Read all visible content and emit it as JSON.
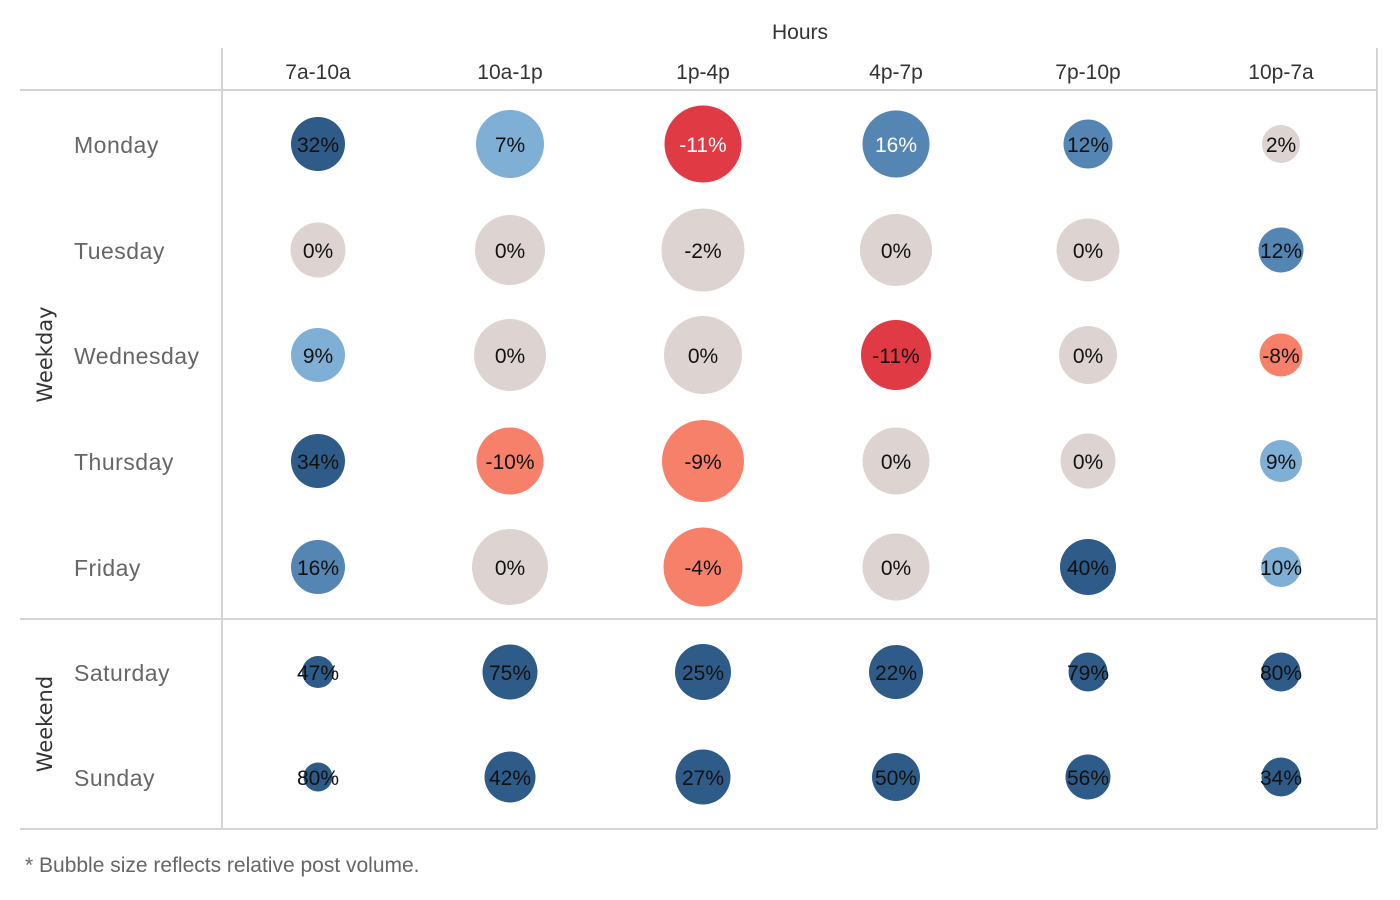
{
  "chart_data": {
    "type": "scatter",
    "subtype": "bubble-grid",
    "title": "",
    "column_header": "Hours",
    "columns": [
      "7a-10a",
      "10a-1p",
      "1p-4p",
      "4p-7p",
      "7p-10p",
      "10p-7a"
    ],
    "groups": [
      {
        "name": "Weekday",
        "rows": [
          "Monday",
          "Tuesday",
          "Wednesday",
          "Thursday",
          "Friday"
        ]
      },
      {
        "name": "Weekend",
        "rows": [
          "Saturday",
          "Sunday"
        ]
      }
    ],
    "cells": [
      {
        "row": "Monday",
        "values": [
          {
            "label": "32%",
            "change": 32,
            "volume": 54,
            "color": "#2e5b87",
            "text_color": "#111111"
          },
          {
            "label": "7%",
            "change": 7,
            "volume": 68,
            "color": "#7fafd4",
            "text_color": "#111111"
          },
          {
            "label": "-11%",
            "change": -11,
            "volume": 77,
            "color": "#e03a44",
            "text_color": "#ffffff"
          },
          {
            "label": "16%",
            "change": 16,
            "volume": 67,
            "color": "#5585b3",
            "text_color": "#ffffff"
          },
          {
            "label": "12%",
            "change": 12,
            "volume": 49,
            "color": "#5585b3",
            "text_color": "#111111"
          },
          {
            "label": "2%",
            "change": 2,
            "volume": 38,
            "color": "#ddd4d2",
            "text_color": "#111111"
          }
        ]
      },
      {
        "row": "Tuesday",
        "values": [
          {
            "label": "0%",
            "change": 0,
            "volume": 55,
            "color": "#ddd4d2",
            "text_color": "#111111"
          },
          {
            "label": "0%",
            "change": 0,
            "volume": 70,
            "color": "#ddd4d2",
            "text_color": "#111111"
          },
          {
            "label": "-2%",
            "change": -2,
            "volume": 83,
            "color": "#ddd4d2",
            "text_color": "#111111"
          },
          {
            "label": "0%",
            "change": 0,
            "volume": 72,
            "color": "#ddd4d2",
            "text_color": "#111111"
          },
          {
            "label": "0%",
            "change": 0,
            "volume": 63,
            "color": "#ddd4d2",
            "text_color": "#111111"
          },
          {
            "label": "12%",
            "change": 12,
            "volume": 45,
            "color": "#5585b3",
            "text_color": "#111111"
          }
        ]
      },
      {
        "row": "Wednesday",
        "values": [
          {
            "label": "9%",
            "change": 9,
            "volume": 54,
            "color": "#7fafd4",
            "text_color": "#111111"
          },
          {
            "label": "0%",
            "change": 0,
            "volume": 72,
            "color": "#ddd4d2",
            "text_color": "#111111"
          },
          {
            "label": "0%",
            "change": 0,
            "volume": 78,
            "color": "#ddd4d2",
            "text_color": "#111111"
          },
          {
            "label": "-11%",
            "change": -11,
            "volume": 70,
            "color": "#e03a44",
            "text_color": "#111111"
          },
          {
            "label": "0%",
            "change": 0,
            "volume": 58,
            "color": "#ddd4d2",
            "text_color": "#111111"
          },
          {
            "label": "-8%",
            "change": -8,
            "volume": 43,
            "color": "#f7806b",
            "text_color": "#111111"
          }
        ]
      },
      {
        "row": "Thursday",
        "values": [
          {
            "label": "34%",
            "change": 34,
            "volume": 54,
            "color": "#2e5b87",
            "text_color": "#111111"
          },
          {
            "label": "-10%",
            "change": -10,
            "volume": 67,
            "color": "#f7806b",
            "text_color": "#111111"
          },
          {
            "label": "-9%",
            "change": -9,
            "volume": 82,
            "color": "#f7806b",
            "text_color": "#111111"
          },
          {
            "label": "0%",
            "change": 0,
            "volume": 67,
            "color": "#ddd4d2",
            "text_color": "#111111"
          },
          {
            "label": "0%",
            "change": 0,
            "volume": 55,
            "color": "#ddd4d2",
            "text_color": "#111111"
          },
          {
            "label": "9%",
            "change": 9,
            "volume": 42,
            "color": "#7fafd4",
            "text_color": "#111111"
          }
        ]
      },
      {
        "row": "Friday",
        "values": [
          {
            "label": "16%",
            "change": 16,
            "volume": 54,
            "color": "#5585b3",
            "text_color": "#111111"
          },
          {
            "label": "0%",
            "change": 0,
            "volume": 76,
            "color": "#ddd4d2",
            "text_color": "#111111"
          },
          {
            "label": "-4%",
            "change": -4,
            "volume": 79,
            "color": "#f7806b",
            "text_color": "#111111"
          },
          {
            "label": "0%",
            "change": 0,
            "volume": 67,
            "color": "#ddd4d2",
            "text_color": "#111111"
          },
          {
            "label": "40%",
            "change": 40,
            "volume": 56,
            "color": "#2e5b87",
            "text_color": "#111111"
          },
          {
            "label": "10%",
            "change": 10,
            "volume": 40,
            "color": "#7fafd4",
            "text_color": "#111111"
          }
        ]
      },
      {
        "row": "Saturday",
        "values": [
          {
            "label": "47%",
            "change": 47,
            "volume": 32,
            "color": "#2e5b87",
            "text_color": "#111111"
          },
          {
            "label": "75%",
            "change": 75,
            "volume": 55,
            "color": "#2e5b87",
            "text_color": "#111111"
          },
          {
            "label": "25%",
            "change": 25,
            "volume": 56,
            "color": "#2e5b87",
            "text_color": "#111111"
          },
          {
            "label": "22%",
            "change": 22,
            "volume": 54,
            "color": "#2e5b87",
            "text_color": "#111111"
          },
          {
            "label": "79%",
            "change": 79,
            "volume": 39,
            "color": "#2e5b87",
            "text_color": "#111111"
          },
          {
            "label": "80%",
            "change": 80,
            "volume": 39,
            "color": "#2e5b87",
            "text_color": "#111111"
          }
        ]
      },
      {
        "row": "Sunday",
        "values": [
          {
            "label": "80%",
            "change": 80,
            "volume": 29,
            "color": "#2e5b87",
            "text_color": "#111111"
          },
          {
            "label": "42%",
            "change": 42,
            "volume": 51,
            "color": "#2e5b87",
            "text_color": "#111111"
          },
          {
            "label": "27%",
            "change": 27,
            "volume": 55,
            "color": "#2e5b87",
            "text_color": "#111111"
          },
          {
            "label": "50%",
            "change": 50,
            "volume": 48,
            "color": "#2e5b87",
            "text_color": "#111111"
          },
          {
            "label": "56%",
            "change": 56,
            "volume": 45,
            "color": "#2e5b87",
            "text_color": "#111111"
          },
          {
            "label": "34%",
            "change": 34,
            "volume": 39,
            "color": "#2e5b87",
            "text_color": "#111111"
          }
        ]
      }
    ],
    "volume_unit": "relative post volume (unitless, larger = more posts)",
    "grid": true,
    "legend": "none"
  },
  "footnote": "* Bubble size reflects relative post volume.",
  "colors": {
    "strong_positive": "#2e5b87",
    "medium_positive": "#5585b3",
    "light_positive": "#7fafd4",
    "neutral": "#ddd4d2",
    "light_negative": "#f7806b",
    "strong_negative": "#e03a44",
    "grid": "#d4d4d4"
  }
}
